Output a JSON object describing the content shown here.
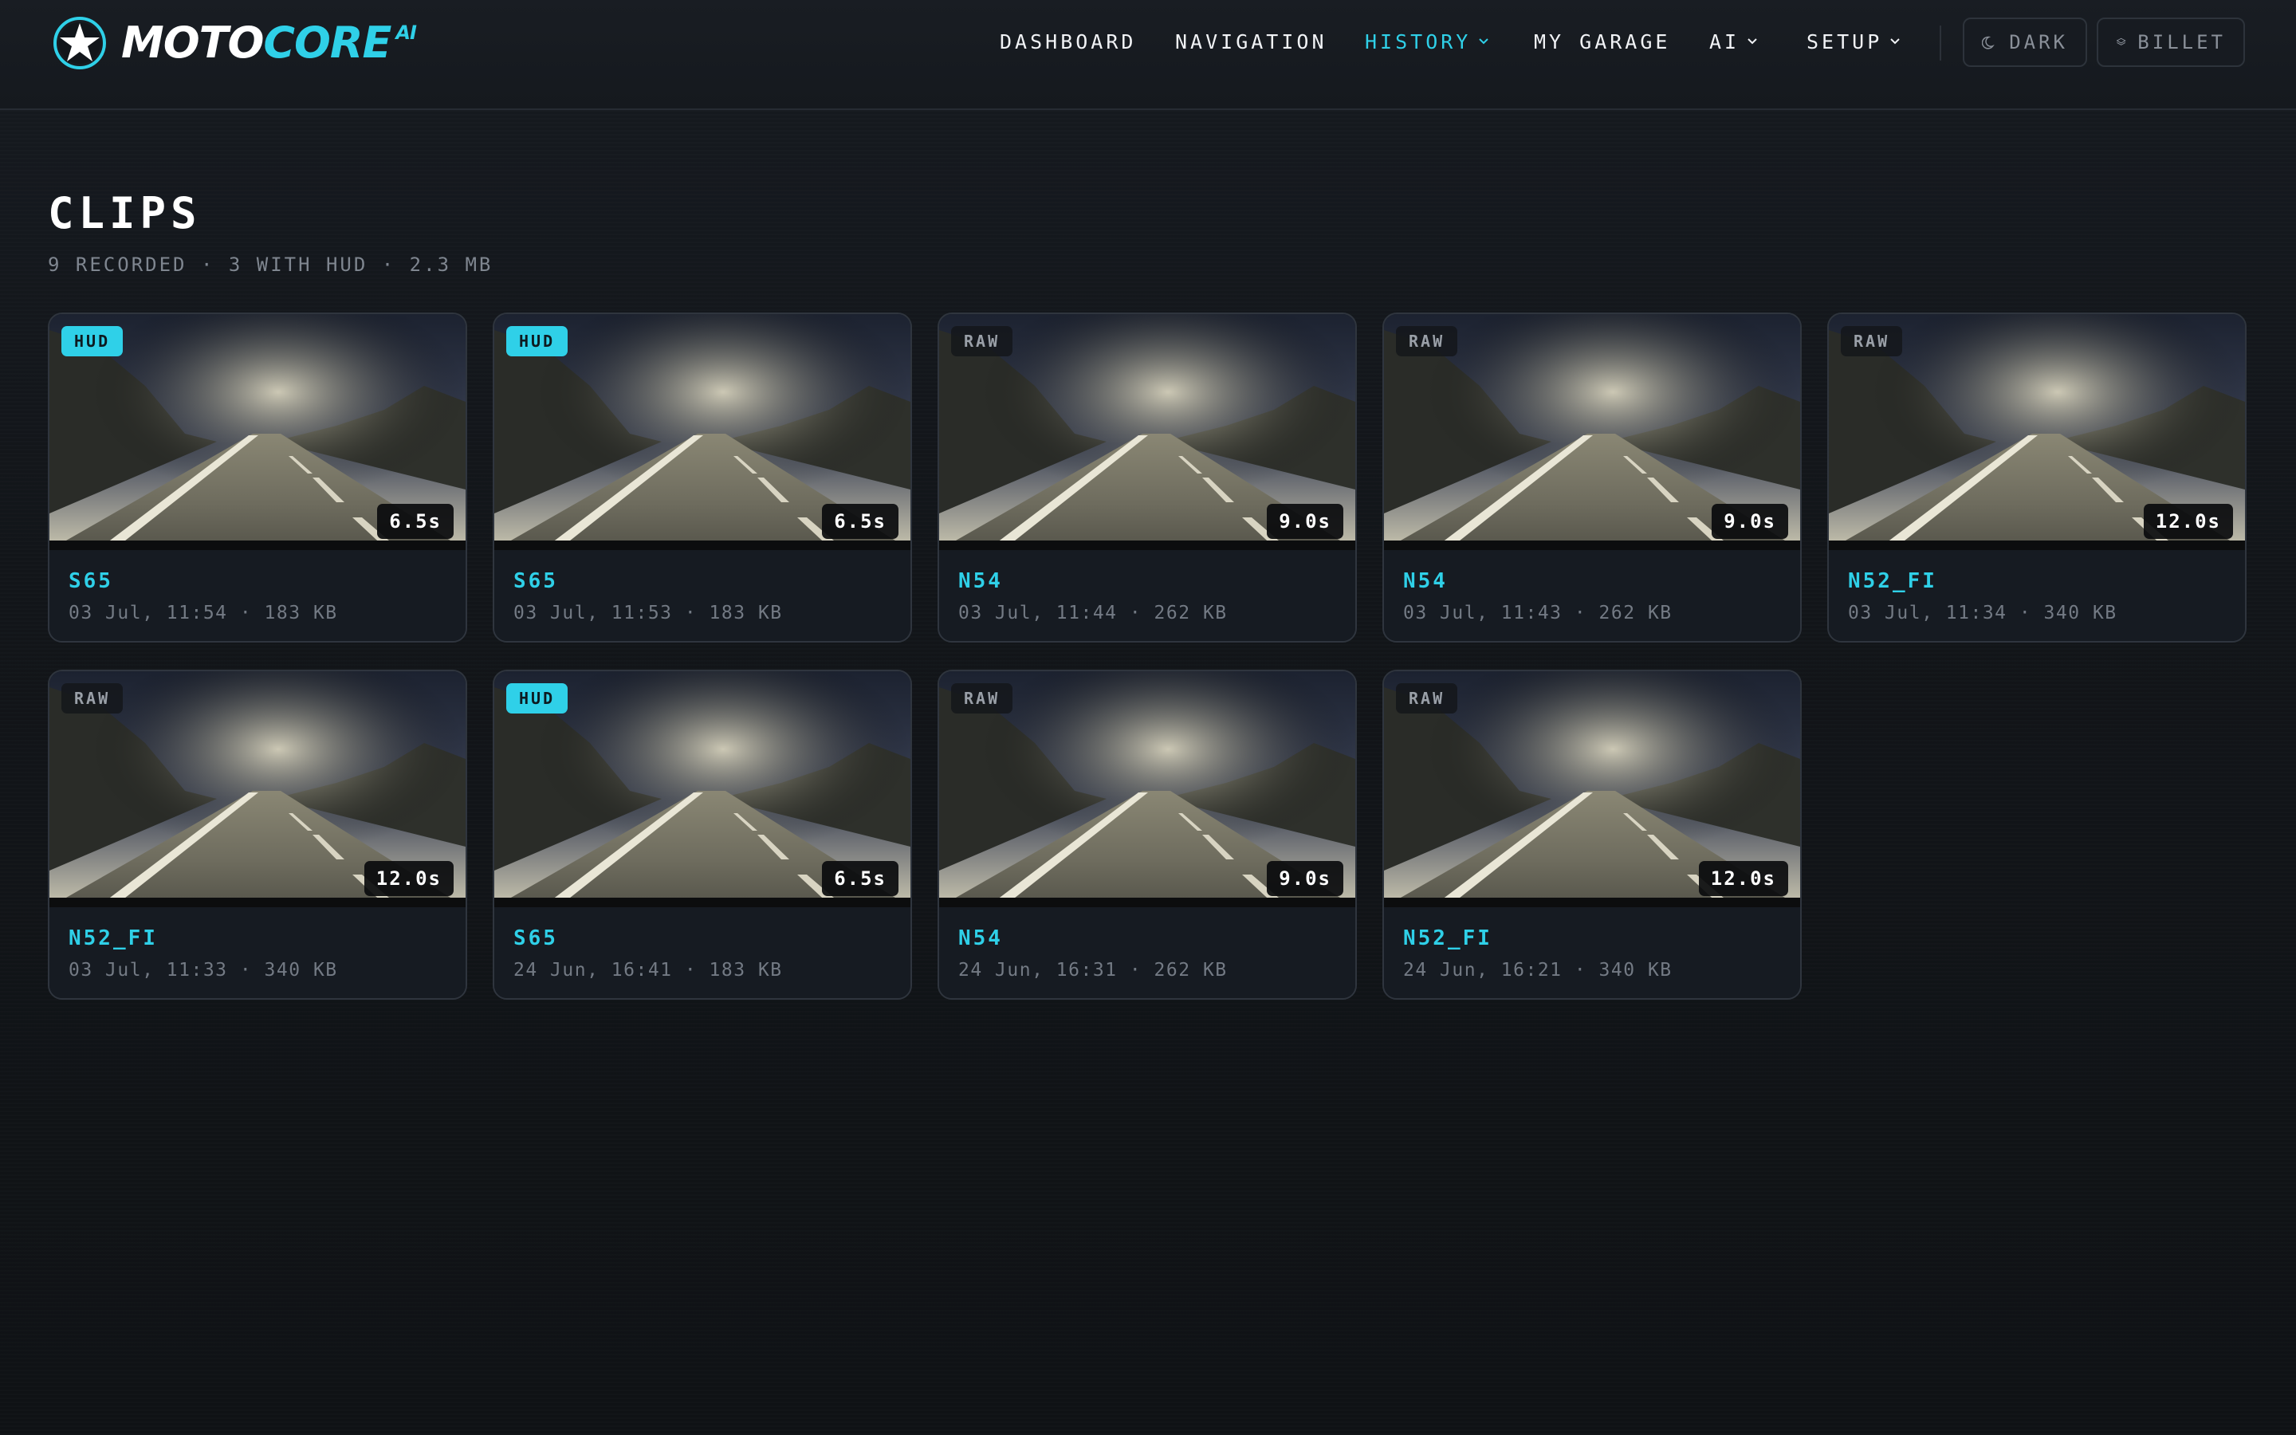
{
  "brand": {
    "moto": "MOTO",
    "core": "CORE",
    "ai": "AI",
    "accent_color": "#2fd0e8"
  },
  "nav": {
    "items": [
      {
        "label": "DASHBOARD",
        "has_dropdown": false,
        "active": false
      },
      {
        "label": "NAVIGATION",
        "has_dropdown": false,
        "active": false
      },
      {
        "label": "HISTORY",
        "has_dropdown": true,
        "active": true
      },
      {
        "label": "MY GARAGE",
        "has_dropdown": false,
        "active": false
      },
      {
        "label": "AI",
        "has_dropdown": true,
        "active": false
      },
      {
        "label": "SETUP",
        "has_dropdown": true,
        "active": false
      }
    ],
    "theme_toggle": {
      "label": "DARK",
      "icon": "moon-icon"
    },
    "skin_toggle": {
      "label": "BILLET",
      "icon": "layers-icon"
    }
  },
  "page": {
    "title": "CLIPS",
    "subtitle": "9 RECORDED · 3 WITH HUD · 2.3 MB"
  },
  "clips": [
    {
      "badge": "HUD",
      "duration": "6.5s",
      "name": "S65",
      "meta": "03 Jul, 11:54 · 183 KB"
    },
    {
      "badge": "HUD",
      "duration": "6.5s",
      "name": "S65",
      "meta": "03 Jul, 11:53 · 183 KB"
    },
    {
      "badge": "RAW",
      "duration": "9.0s",
      "name": "N54",
      "meta": "03 Jul, 11:44 · 262 KB"
    },
    {
      "badge": "RAW",
      "duration": "9.0s",
      "name": "N54",
      "meta": "03 Jul, 11:43 · 262 KB"
    },
    {
      "badge": "RAW",
      "duration": "12.0s",
      "name": "N52_FI",
      "meta": "03 Jul, 11:34 · 340 KB"
    },
    {
      "badge": "RAW",
      "duration": "12.0s",
      "name": "N52_FI",
      "meta": "03 Jul, 11:33 · 340 KB"
    },
    {
      "badge": "HUD",
      "duration": "6.5s",
      "name": "S65",
      "meta": "24 Jun, 16:41 · 183 KB"
    },
    {
      "badge": "RAW",
      "duration": "9.0s",
      "name": "N54",
      "meta": "24 Jun, 16:31 · 262 KB"
    },
    {
      "badge": "RAW",
      "duration": "12.0s",
      "name": "N52_FI",
      "meta": "24 Jun, 16:21 · 340 KB"
    }
  ]
}
